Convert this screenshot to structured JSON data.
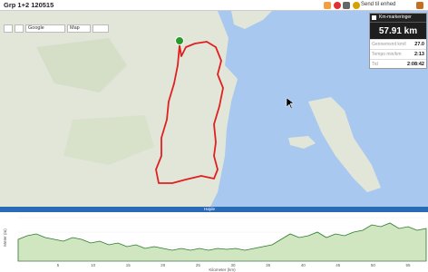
{
  "page": {
    "title": "Grp 1+2 120515",
    "send_label": "Send til enhed"
  },
  "map_controls": {
    "map_source": "Google",
    "map_type": "Map"
  },
  "stats": {
    "km_markers_label": "Km-markeringer",
    "distance": "57.91 km",
    "rows": [
      {
        "label": "Gennemsnit km/t",
        "value": "27.0"
      },
      {
        "label": "Tempo min/km",
        "value": "2:13"
      },
      {
        "label": "Tid",
        "value": "2:08:42"
      }
    ]
  },
  "elevation": {
    "tab_label": "Højde",
    "y_label": "Meter (m)",
    "x_label": "Kilometer (km)",
    "x_ticks": [
      "5",
      "10",
      "15",
      "20",
      "25",
      "30",
      "35",
      "40",
      "45",
      "50",
      "55"
    ],
    "y_ticks": [
      "60",
      "40",
      "20"
    ]
  },
  "colors": {
    "route": "#e02020",
    "start_marker": "#2a9a2a",
    "sea": "#a8c8f0",
    "land": "#e2e6d8",
    "elevation_fill": "#cfe6c0",
    "elevation_line": "#2a7a2a",
    "header_blue": "#2a6bb8"
  }
}
